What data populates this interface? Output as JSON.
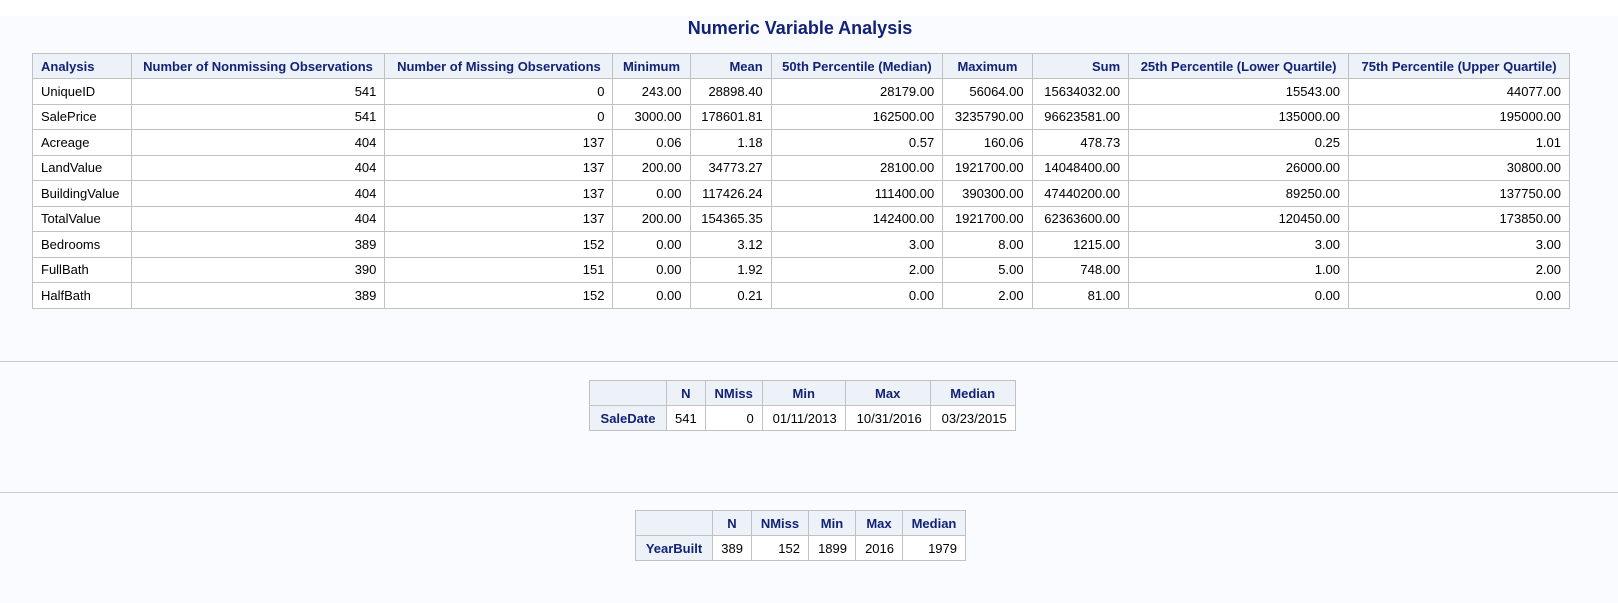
{
  "title": "Numeric Variable Analysis",
  "main_table": {
    "headers": [
      "Analysis",
      "Number of Nonmissing Observations",
      "Number of Missing Observations",
      "Minimum",
      "Mean",
      "50th Percentile (Median)",
      "Maximum",
      "Sum",
      "25th Percentile (Lower Quartile)",
      "75th Percentile (Upper Quartile)"
    ],
    "rows": [
      [
        "UniqueID",
        "541",
        "0",
        "243.00",
        "28898.40",
        "28179.00",
        "56064.00",
        "15634032.00",
        "15543.00",
        "44077.00"
      ],
      [
        "SalePrice",
        "541",
        "0",
        "3000.00",
        "178601.81",
        "162500.00",
        "3235790.00",
        "96623581.00",
        "135000.00",
        "195000.00"
      ],
      [
        "Acreage",
        "404",
        "137",
        "0.06",
        "1.18",
        "0.57",
        "160.06",
        "478.73",
        "0.25",
        "1.01"
      ],
      [
        "LandValue",
        "404",
        "137",
        "200.00",
        "34773.27",
        "28100.00",
        "1921700.00",
        "14048400.00",
        "26000.00",
        "30800.00"
      ],
      [
        "BuildingValue",
        "404",
        "137",
        "0.00",
        "117426.24",
        "111400.00",
        "390300.00",
        "47440200.00",
        "89250.00",
        "137750.00"
      ],
      [
        "TotalValue",
        "404",
        "137",
        "200.00",
        "154365.35",
        "142400.00",
        "1921700.00",
        "62363600.00",
        "120450.00",
        "173850.00"
      ],
      [
        "Bedrooms",
        "389",
        "152",
        "0.00",
        "3.12",
        "3.00",
        "8.00",
        "1215.00",
        "3.00",
        "3.00"
      ],
      [
        "FullBath",
        "390",
        "151",
        "0.00",
        "1.92",
        "2.00",
        "5.00",
        "748.00",
        "1.00",
        "2.00"
      ],
      [
        "HalfBath",
        "389",
        "152",
        "0.00",
        "0.21",
        "0.00",
        "2.00",
        "81.00",
        "0.00",
        "0.00"
      ]
    ]
  },
  "sale_date_table": {
    "headers": [
      "N",
      "NMiss",
      "Min",
      "Max",
      "Median"
    ],
    "row_label": "SaleDate",
    "values": [
      "541",
      "0",
      "01/11/2013",
      "10/31/2016",
      "03/23/2015"
    ]
  },
  "year_built_table": {
    "headers": [
      "N",
      "NMiss",
      "Min",
      "Max",
      "Median"
    ],
    "row_label": "YearBuilt",
    "values": [
      "389",
      "152",
      "1899",
      "2016",
      "1979"
    ]
  },
  "colors": {
    "header_text": "#112277",
    "header_bg": "#edf2f9",
    "border": "#c1c1c1",
    "page_bg": "#fafbfe"
  }
}
